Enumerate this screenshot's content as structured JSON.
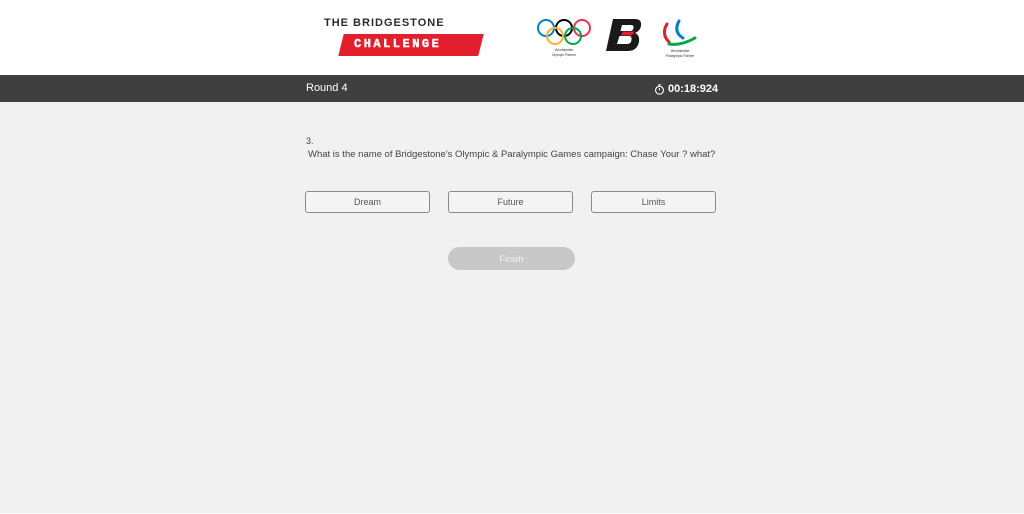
{
  "header": {
    "brand_title": "THE BRIDGESTONE",
    "brand_badge": "CHALLENGE",
    "olympic_caption_line1": "Worldwide",
    "olympic_caption_line2": "Olympic Partner",
    "paralympic_caption_line1": "Worldwide",
    "paralympic_caption_line2": "Paralympic Partner",
    "icons": [
      "olympic-rings-icon",
      "bridgestone-b-icon",
      "paralympic-agitos-icon"
    ]
  },
  "status_bar": {
    "round_label": "Round 4",
    "timer_value": "00:18:924",
    "timer_icon": "stopwatch-icon"
  },
  "question": {
    "number": "3.",
    "text": "What is the name of Bridgestone's Olympic & Paralympic Games campaign: Chase Your ? what?",
    "answers": [
      {
        "label": "Dream"
      },
      {
        "label": "Future"
      },
      {
        "label": "Limits"
      }
    ]
  },
  "actions": {
    "finish_label": "Finish"
  },
  "colors": {
    "brand_red": "#e31e2d",
    "bar_background": "#3f3f40",
    "page_background": "#f1f1f1",
    "finish_disabled": "#c8c8c8"
  }
}
